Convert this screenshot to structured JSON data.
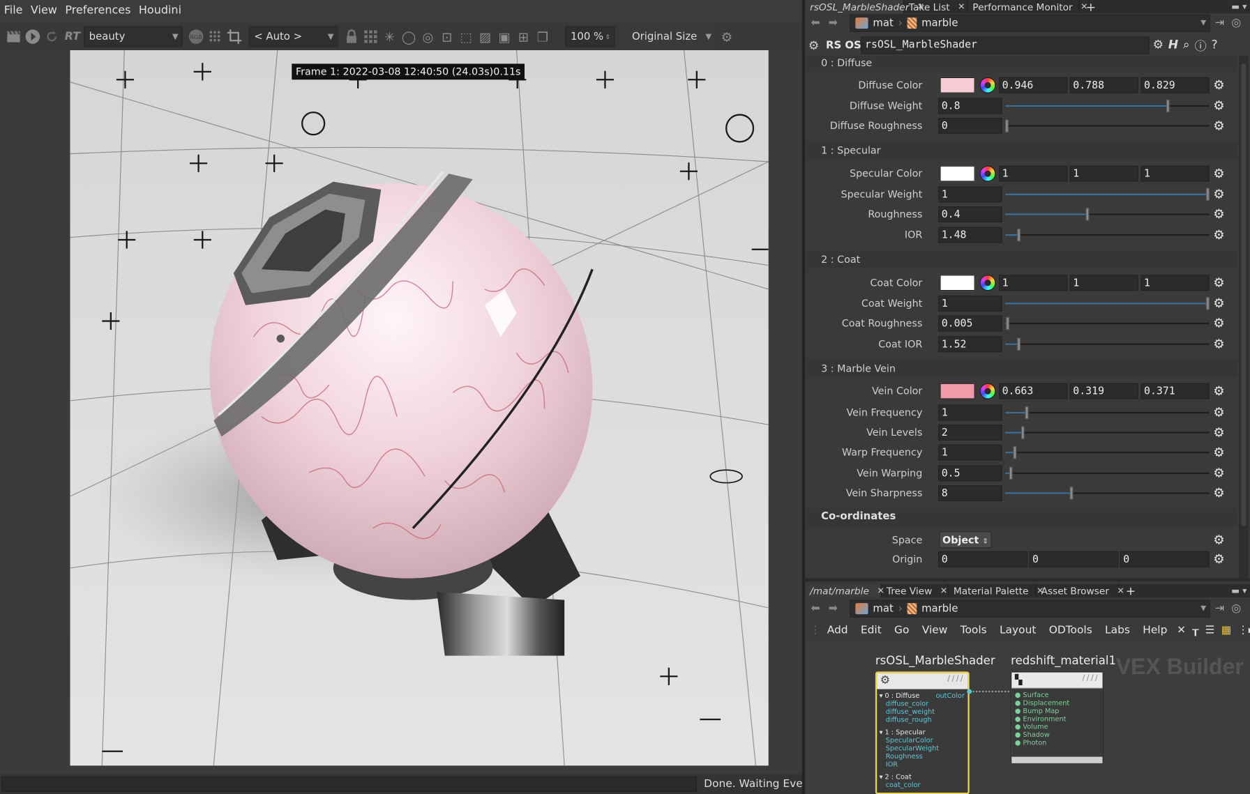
{
  "menubar": {
    "items": [
      "File",
      "View",
      "Preferences",
      "Houdini"
    ]
  },
  "viewer": {
    "rt_label": "RT",
    "aov": "beauty",
    "auto_label": "< Auto >",
    "zoom": "100 %",
    "size_mode": "Original Size",
    "frame_label": "Frame 1: 2022-03-08 12:40:50 (24.03s)0.11s",
    "status": "Done. Waiting Events"
  },
  "top_tabs": {
    "tabs": [
      "rsOSL_MarbleShader",
      "Take List",
      "Performance Monitor"
    ],
    "path": [
      "mat",
      "marble"
    ]
  },
  "param_header": {
    "type": "RS OSL",
    "name": "rsOSL_MarbleShader"
  },
  "sections": {
    "diffuse": "0 : Diffuse",
    "specular": "1 : Specular",
    "coat": "2 : Coat",
    "vein": "3 : Marble Vein",
    "coords": "Co-ordinates"
  },
  "params": {
    "diffuse_color": {
      "label": "Diffuse Color",
      "swatch": "#f6cdd6",
      "r": "0.946",
      "g": "0.788",
      "b": "0.829"
    },
    "diffuse_weight": {
      "label": "Diffuse Weight",
      "value": "0.8",
      "fraction": 0.8
    },
    "diffuse_roughness": {
      "label": "Diffuse Roughness",
      "value": "0",
      "fraction": 0.0
    },
    "specular_color": {
      "label": "Specular Color",
      "swatch": "#ffffff",
      "r": "1",
      "g": "1",
      "b": "1"
    },
    "specular_weight": {
      "label": "Specular Weight",
      "value": "1",
      "fraction": 1.0
    },
    "roughness": {
      "label": "Roughness",
      "value": "0.4",
      "fraction": 0.4
    },
    "ior": {
      "label": "IOR",
      "value": "1.48",
      "fraction": 0.06
    },
    "coat_color": {
      "label": "Coat Color",
      "swatch": "#ffffff",
      "r": "1",
      "g": "1",
      "b": "1"
    },
    "coat_weight": {
      "label": "Coat Weight",
      "value": "1",
      "fraction": 1.0
    },
    "coat_roughness": {
      "label": "Coat Roughness",
      "value": "0.005",
      "fraction": 0.005
    },
    "coat_ior": {
      "label": "Coat IOR",
      "value": "1.52",
      "fraction": 0.06
    },
    "vein_color": {
      "label": "Vein Color",
      "swatch": "#f29aaa",
      "r": "0.663",
      "g": "0.319",
      "b": "0.371"
    },
    "vein_frequency": {
      "label": "Vein Frequency",
      "value": "1",
      "fraction": 0.1
    },
    "vein_levels": {
      "label": "Vein Levels",
      "value": "2",
      "fraction": 0.08
    },
    "warp_frequency": {
      "label": "Warp Frequency",
      "value": "1",
      "fraction": 0.04
    },
    "vein_warping": {
      "label": "Vein Warping",
      "value": "0.5",
      "fraction": 0.02
    },
    "vein_sharpness": {
      "label": "Vein Sharpness",
      "value": "8",
      "fraction": 0.32
    },
    "space": {
      "label": "Space",
      "value": "Object"
    },
    "origin": {
      "label": "Origin",
      "x": "0",
      "y": "0",
      "z": "0"
    }
  },
  "bottom_tabs": {
    "tabs": [
      "/mat/marble",
      "Tree View",
      "Material Palette",
      "Asset Browser"
    ],
    "path": [
      "mat",
      "marble"
    ]
  },
  "net_menu": [
    "Add",
    "Edit",
    "Go",
    "View",
    "Tools",
    "Layout",
    "ODTools",
    "Labs",
    "Help"
  ],
  "network": {
    "context_label": "VEX Builder",
    "node1": {
      "name": "rsOSL_MarbleShader",
      "output": "outColor",
      "groups": [
        {
          "title": "0 : Diffuse",
          "ports": [
            "diffuse_color",
            "diffuse_weight",
            "diffuse_rough"
          ]
        },
        {
          "title": "1 : Specular",
          "ports": [
            "SpecularColor",
            "SpecularWeight",
            "Roughness",
            "IOR"
          ]
        },
        {
          "title": "2 : Coat",
          "ports": [
            "coat_color"
          ]
        }
      ]
    },
    "node2": {
      "name": "redshift_material1",
      "ports": [
        "Surface",
        "Displacement",
        "Bump Map",
        "Environment",
        "Volume",
        "Shadow",
        "Photon"
      ]
    }
  }
}
